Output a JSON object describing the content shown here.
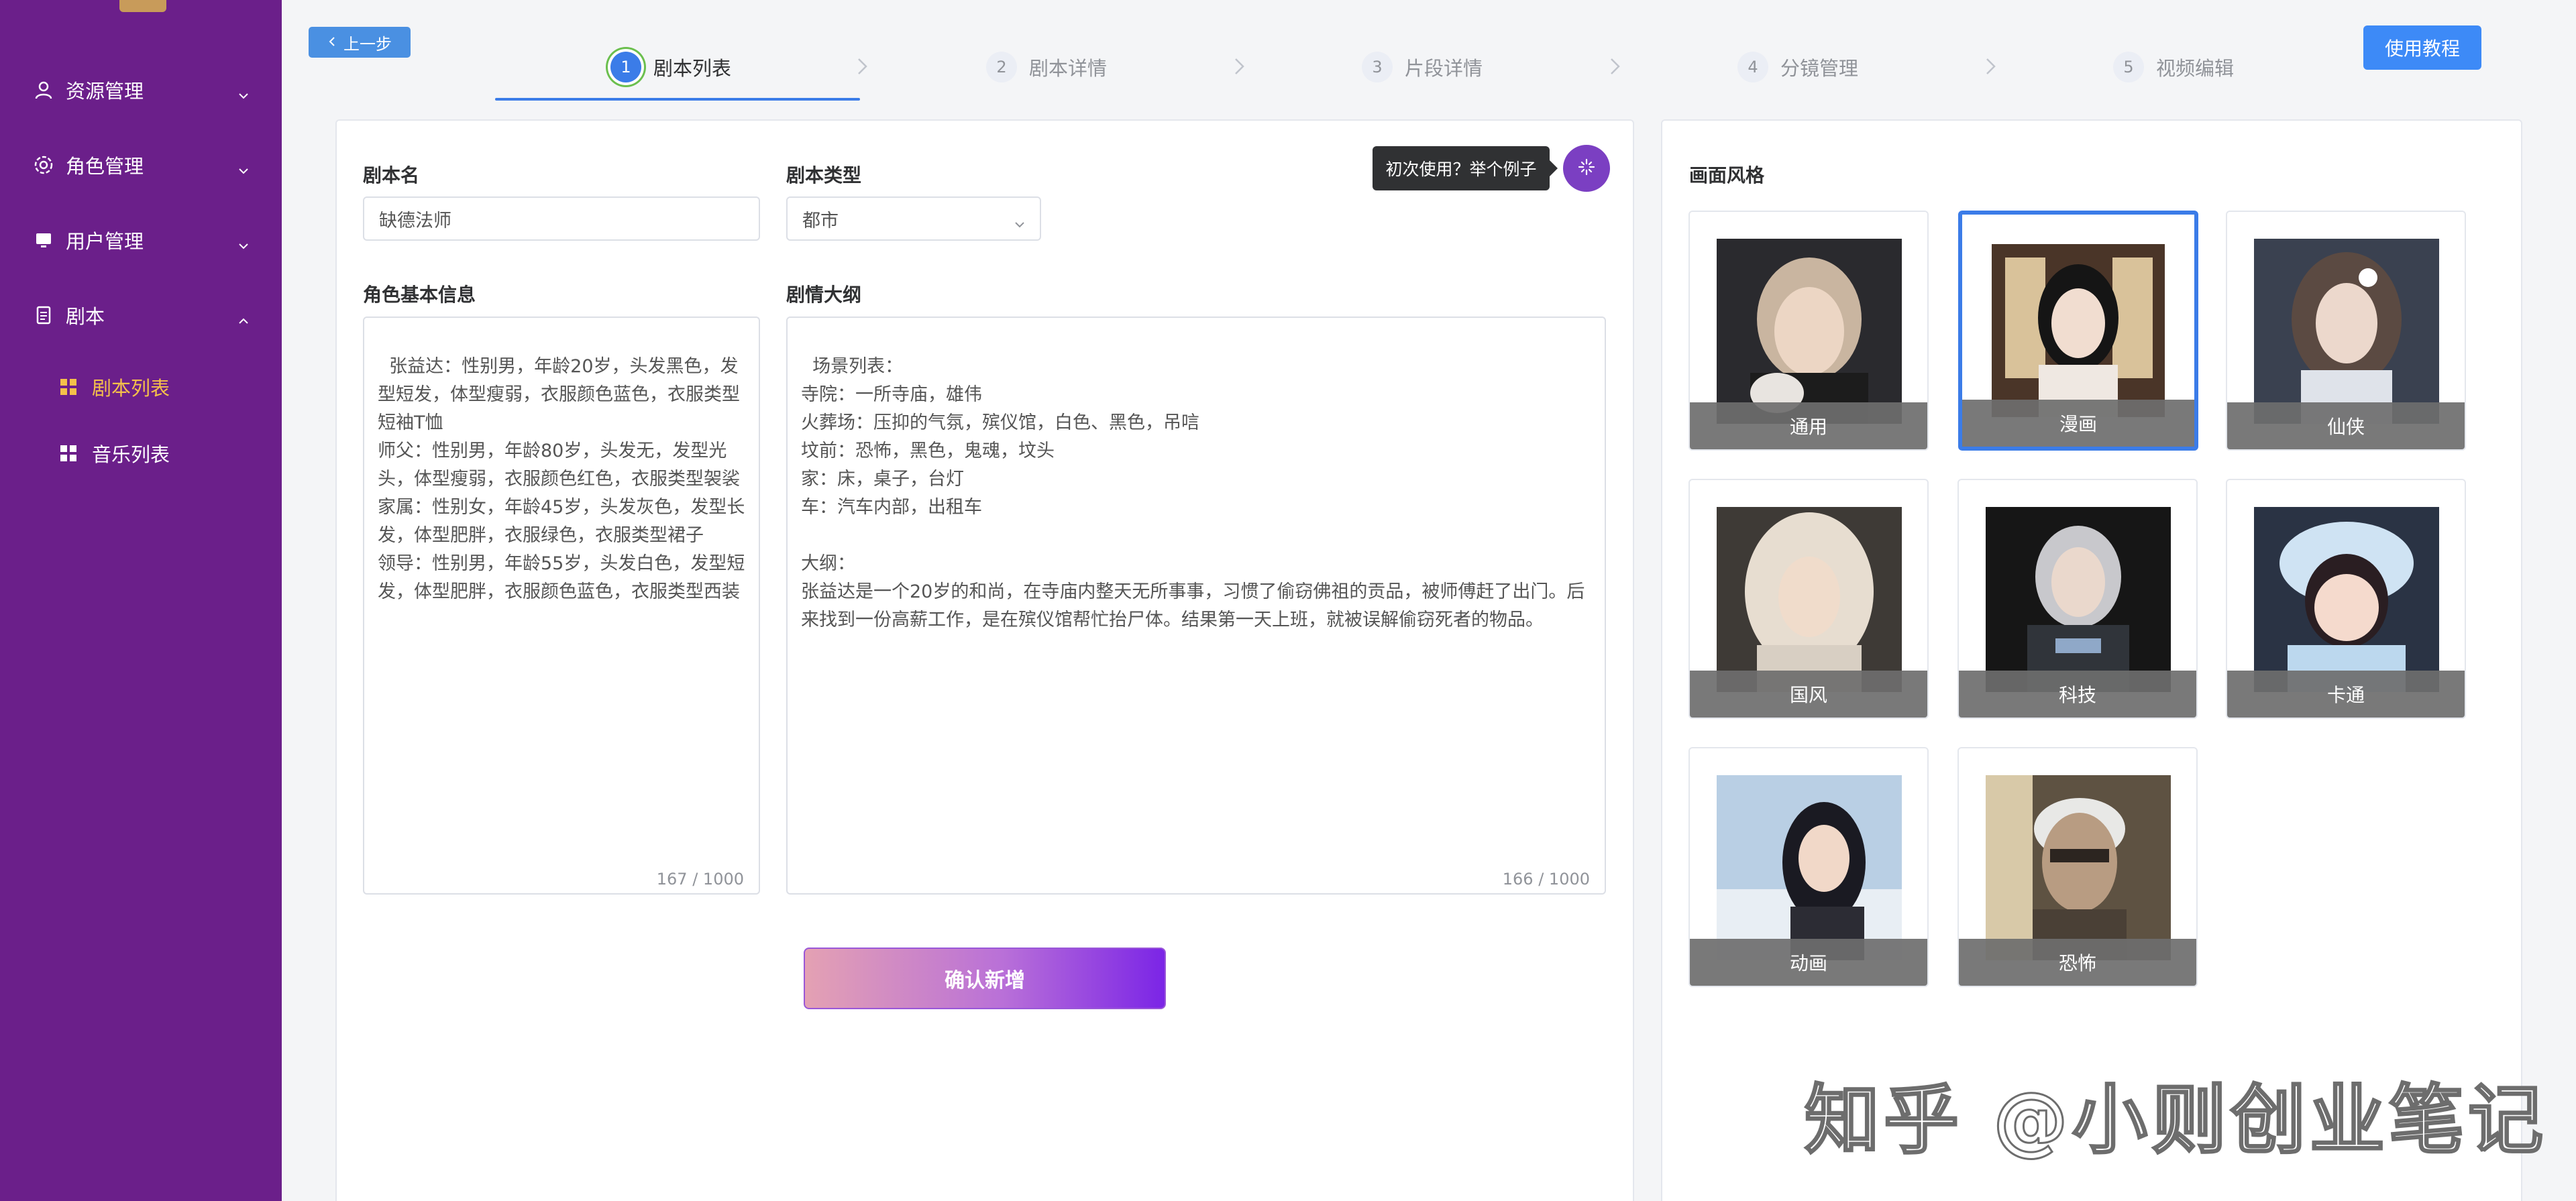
{
  "sidebar": {
    "items": [
      {
        "label": "资源管理",
        "icon": "user-icon"
      },
      {
        "label": "角色管理",
        "icon": "gear-icon"
      },
      {
        "label": "用户管理",
        "icon": "monitor-icon"
      },
      {
        "label": "剧本",
        "icon": "document-icon"
      }
    ],
    "sub_items": [
      {
        "label": "剧本列表",
        "active": true
      },
      {
        "label": "音乐列表",
        "active": false
      }
    ],
    "colors": {
      "bg": "#6b1f8a",
      "active_sub": "#f5c04a"
    }
  },
  "header": {
    "back_label": "上一步",
    "steps": [
      {
        "num": "1",
        "label": "剧本列表"
      },
      {
        "num": "2",
        "label": "剧本详情"
      },
      {
        "num": "3",
        "label": "片段详情"
      },
      {
        "num": "4",
        "label": "分镜管理"
      },
      {
        "num": "5",
        "label": "视频编辑"
      }
    ],
    "active_step": 1,
    "tutorial_label": "使用教程"
  },
  "form": {
    "name_label": "剧本名",
    "name_value": "缺德法师",
    "type_label": "剧本类型",
    "type_value": "都市",
    "tooltip": "初次使用？举个例子",
    "roles_label": "角色基本信息",
    "roles_text": "张益达：性别男，年龄20岁，头发黑色，发型短发，体型瘦弱，衣服颜色蓝色，衣服类型短袖T恤\n师父：性别男，年龄80岁，头发无，发型光头，体型瘦弱，衣服颜色红色，衣服类型袈裟\n家属：性别女，年龄45岁，头发灰色，发型长发，体型肥胖，衣服绿色，衣服类型裙子\n领导：性别男，年龄55岁，头发白色，发型短发，体型肥胖，衣服颜色蓝色，衣服类型西装",
    "roles_count": "167 / 1000",
    "plot_label": "剧情大纲",
    "plot_text": "场景列表：\n寺院：一所寺庙，雄伟\n火葬场：压抑的气氛，殡仪馆，白色、黑色，吊唁\n坟前：恐怖，黑色，鬼魂，坟头\n家：床，桌子，台灯\n车：汽车内部，出租车\n\n大纲：\n张益达是一个20岁的和尚，在寺庙内整天无所事事，习惯了偷窃佛祖的贡品，被师傅赶了出门。后来找到一份高薪工作，是在殡仪馆帮忙抬尸体。结果第一天上班，就被误解偷窃死者的物品。",
    "plot_count": "166 / 1000",
    "confirm_label": "确认新增"
  },
  "styles": {
    "title": "画面风格",
    "items": [
      {
        "label": "通用",
        "selected": false
      },
      {
        "label": "漫画",
        "selected": true
      },
      {
        "label": "仙侠",
        "selected": false
      },
      {
        "label": "国风",
        "selected": false
      },
      {
        "label": "科技",
        "selected": false
      },
      {
        "label": "卡通",
        "selected": false
      },
      {
        "label": "动画",
        "selected": false
      },
      {
        "label": "恐怖",
        "selected": false
      }
    ]
  },
  "watermark": "知乎 @小则创业笔记"
}
